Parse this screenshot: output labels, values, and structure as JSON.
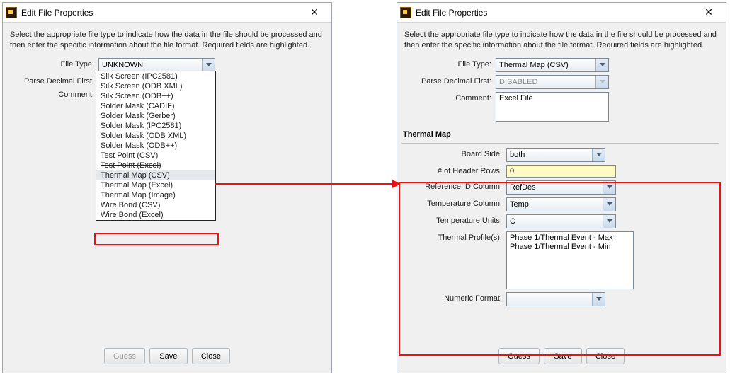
{
  "left": {
    "title": "Edit File Properties",
    "intro": "Select the appropriate file type to indicate how the data in the file should be processed and then enter the specific information about the file format. Required fields are highlighted.",
    "labels": {
      "file_type": "File Type:",
      "parse_decimal": "Parse Decimal First:",
      "comment": "Comment:"
    },
    "file_type_value": "UNKNOWN",
    "dropdown_items": [
      "Silk Screen (IPC2581)",
      "Silk Screen (ODB XML)",
      "Silk Screen (ODB++)",
      "Solder Mask (CADIF)",
      "Solder Mask (Gerber)",
      "Solder Mask (IPC2581)",
      "Solder Mask (ODB XML)",
      "Solder Mask (ODB++)",
      "Test Point (CSV)",
      "Test Point (Excel)",
      "Thermal Map (CSV)",
      "Thermal Map (Excel)",
      "Thermal Map (Image)",
      "Wire Bond (CSV)",
      "Wire Bond (Excel)"
    ],
    "footer": {
      "guess": "Guess",
      "save": "Save",
      "close": "Close"
    }
  },
  "right": {
    "title": "Edit File Properties",
    "intro": "Select the appropriate file type to indicate how the data in the file should be processed and then enter the specific information about the file format. Required fields are highlighted.",
    "labels": {
      "file_type": "File Type:",
      "parse_decimal": "Parse Decimal First:",
      "comment": "Comment:"
    },
    "file_type_value": "Thermal Map (CSV)",
    "parse_decimal_value": "DISABLED",
    "comment_value": "Excel File",
    "group_label": "Thermal Map",
    "fields": {
      "board_side": {
        "label": "Board Side:",
        "value": "both"
      },
      "header_rows": {
        "label": "# of Header Rows:",
        "value": "0"
      },
      "ref_id": {
        "label": "Reference ID Column:",
        "value": "RefDes"
      },
      "temp_col": {
        "label": "Temperature Column:",
        "value": "Temp"
      },
      "temp_units": {
        "label": "Temperature Units:",
        "value": "C"
      },
      "profiles": {
        "label": "Thermal Profile(s):",
        "values": [
          "Phase 1/Thermal Event - Max",
          "Phase 1/Thermal Event - Min"
        ]
      },
      "num_fmt": {
        "label": "Numeric Format:",
        "value": ""
      }
    },
    "footer": {
      "guess": "Guess",
      "save": "Save",
      "close": "Close"
    }
  }
}
